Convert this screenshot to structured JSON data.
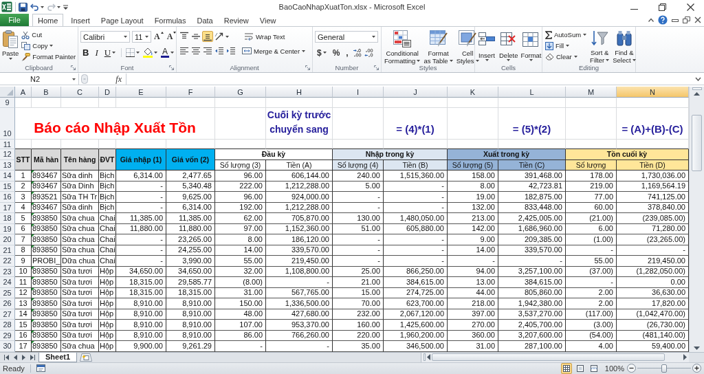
{
  "window": {
    "title": "BaoCaoNhapXuatTon.xlsx - Microsoft Excel"
  },
  "ribbon_tabs": [
    {
      "label": "File",
      "kind": "file",
      "selected": false
    },
    {
      "label": "Home",
      "kind": "tab",
      "selected": true
    },
    {
      "label": "Insert",
      "kind": "tab",
      "selected": false
    },
    {
      "label": "Page Layout",
      "kind": "tab",
      "selected": false
    },
    {
      "label": "Formulas",
      "kind": "tab",
      "selected": false
    },
    {
      "label": "Data",
      "kind": "tab",
      "selected": false
    },
    {
      "label": "Review",
      "kind": "tab",
      "selected": false
    },
    {
      "label": "View",
      "kind": "tab",
      "selected": false
    }
  ],
  "ribbon": {
    "clipboard": {
      "label": "Clipboard",
      "paste": "Paste",
      "cut": "Cut",
      "copy": "Copy",
      "format_painter": "Format Painter"
    },
    "font": {
      "label": "Font",
      "font_name": "Calibri",
      "font_size": "11",
      "grow_font": "A",
      "shrink_font": "A",
      "bold": "B",
      "italic": "I",
      "underline": "U",
      "font_color": "A"
    },
    "alignment": {
      "label": "Alignment",
      "button_rows": [
        [
          {
            "kind": "top",
            "selected": false
          },
          {
            "kind": "middle",
            "selected": false
          },
          {
            "kind": "bottom",
            "selected": true
          },
          {
            "kind": "orientation",
            "selected": false
          }
        ],
        [
          {
            "kind": "left",
            "selected": false
          },
          {
            "kind": "center",
            "selected": false
          },
          {
            "kind": "right",
            "selected": false
          },
          {
            "kind": "outdent",
            "selected": false
          },
          {
            "kind": "indent",
            "selected": false
          }
        ]
      ],
      "wrap_text": "Wrap Text",
      "merge_center": "Merge & Center"
    },
    "number": {
      "label": "Number",
      "format": "General",
      "currency": "$",
      "percent": "%",
      "comma": ","
    },
    "styles": {
      "label": "Styles",
      "buttons": [
        {
          "kind": "conditional",
          "lines": [
            "Conditional",
            "Formatting"
          ]
        },
        {
          "kind": "table",
          "lines": [
            "Format",
            "as Table"
          ]
        },
        {
          "kind": "cell_styles",
          "lines": [
            "Cell",
            "Styles"
          ]
        }
      ]
    },
    "cells": {
      "label": "Cells",
      "buttons": [
        {
          "kind": "insert",
          "label": "Insert"
        },
        {
          "kind": "delete",
          "label": "Delete"
        },
        {
          "kind": "format",
          "label": "Format"
        }
      ]
    },
    "editing": {
      "label": "Editing",
      "autosum": "AutoSum",
      "fill": "Fill",
      "clear": "Clear",
      "buttons": [
        {
          "kind": "sort",
          "lines": [
            "Sort &",
            "Filter"
          ]
        },
        {
          "kind": "find",
          "lines": [
            "Find &",
            "Select"
          ]
        }
      ]
    }
  },
  "formula_bar": {
    "name_box": "N2",
    "function_label": "fx"
  },
  "sheet": {
    "columns": [
      {
        "label": "A",
        "selected": false
      },
      {
        "label": "B",
        "selected": false
      },
      {
        "label": "C",
        "selected": false
      },
      {
        "label": "D",
        "selected": false
      },
      {
        "label": "E",
        "selected": false
      },
      {
        "label": "F",
        "selected": false
      },
      {
        "label": "G",
        "selected": false
      },
      {
        "label": "H",
        "selected": false
      },
      {
        "label": "I",
        "selected": false
      },
      {
        "label": "J",
        "selected": false
      },
      {
        "label": "K",
        "selected": false
      },
      {
        "label": "L",
        "selected": false
      },
      {
        "label": "M",
        "selected": false
      },
      {
        "label": "N",
        "selected": true
      }
    ],
    "row_numbers": [
      "9",
      "10",
      "11",
      "12",
      "13",
      "14",
      "15",
      "16",
      "17",
      "18",
      "19",
      "20",
      "21",
      "22",
      "23",
      "24",
      "25",
      "26",
      "27",
      "28",
      "29",
      "30"
    ],
    "title": "Báo cáo Nhập Xuất Tồn",
    "opening_note": "Cuối kỳ trước chuyển sang",
    "formulas": {
      "import": "= (4)*(1)",
      "export": "= (5)*(2)",
      "closing": "= (A)+(B)-(C)"
    },
    "header": {
      "fixed": [
        "STT",
        "Mã hàn",
        "Tên hàng",
        "ĐVT"
      ],
      "prices": [
        "Giá nhập (1)",
        "Giá vốn (2)"
      ],
      "groups": [
        {
          "label": "Đầu kỳ",
          "color": "#ffffff",
          "columns": [
            "Số lượng (3)",
            "Tiền (A)"
          ]
        },
        {
          "label": "Nhập trong kỳ",
          "color": "#dce6f1",
          "columns": [
            "Số lượng (4)",
            "Tiền (B)"
          ]
        },
        {
          "label": "Xuất trong kỳ",
          "color": "#95b3d7",
          "columns": [
            "Số lượng (5)",
            "Tiền (C)"
          ]
        },
        {
          "label": "Tồn cuối kỳ",
          "color": "#ffe699",
          "columns": [
            "Số lượng",
            "Tiền (D)"
          ]
        }
      ]
    },
    "rows": [
      {
        "flagged": true,
        "cells": [
          "1",
          "893467",
          "Sữa dinh",
          "Bịch",
          "6,314.00",
          "2,477.65",
          "96.00",
          "606,144.00",
          "240.00",
          "1,515,360.00",
          "158.00",
          "391,468.00",
          "178.00",
          "1,730,036.00"
        ]
      },
      {
        "flagged": true,
        "cells": [
          "2",
          "893467",
          "Sữa Dinh",
          "Bịch",
          "-",
          "5,340.48",
          "222.00",
          "1,212,288.00",
          "5.00",
          "-",
          "8.00",
          "42,723.81",
          "219.00",
          "1,169,564.19"
        ]
      },
      {
        "flagged": true,
        "cells": [
          "3",
          "893521",
          "Sữa TH Tr",
          "Bịch",
          "-",
          "9,625.00",
          "96.00",
          "924,000.00",
          "-",
          "-",
          "19.00",
          "182,875.00",
          "77.00",
          "741,125.00"
        ]
      },
      {
        "flagged": true,
        "cells": [
          "4",
          "893467",
          "Sữa dinh",
          "Bịch",
          "-",
          "6,314.00",
          "192.00",
          "1,212,288.00",
          "-",
          "-",
          "132.00",
          "833,448.00",
          "60.00",
          "378,840.00"
        ]
      },
      {
        "flagged": true,
        "cells": [
          "5",
          "893850",
          "Sữa chua",
          "Chai",
          "11,385.00",
          "11,385.00",
          "62.00",
          "705,870.00",
          "130.00",
          "1,480,050.00",
          "213.00",
          "2,425,005.00",
          "(21.00)",
          "(239,085.00)"
        ]
      },
      {
        "flagged": true,
        "cells": [
          "6",
          "893850",
          "Sữa chua",
          "Chai",
          "11,880.00",
          "11,880.00",
          "97.00",
          "1,152,360.00",
          "51.00",
          "605,880.00",
          "142.00",
          "1,686,960.00",
          "6.00",
          "71,280.00"
        ]
      },
      {
        "flagged": true,
        "cells": [
          "7",
          "893850",
          "Sữa chua",
          "Chai",
          "-",
          "23,265.00",
          "8.00",
          "186,120.00",
          "-",
          "-",
          "9.00",
          "209,385.00",
          "(1.00)",
          "(23,265.00)"
        ]
      },
      {
        "flagged": true,
        "cells": [
          "8",
          "893850",
          "Sữa chua",
          "Chai",
          "-",
          "24,255.00",
          "14.00",
          "339,570.00",
          "-",
          "-",
          "14.00",
          "339,570.00",
          "-",
          "-"
        ]
      },
      {
        "flagged": false,
        "cells": [
          "9",
          "PROBI_",
          "Dữa chua",
          "Chai",
          "-",
          "3,990.00",
          "55.00",
          "219,450.00",
          "-",
          "-",
          "-",
          "-",
          "55.00",
          "219,450.00"
        ]
      },
      {
        "flagged": true,
        "cells": [
          "10",
          "893850",
          "Sữa tươi",
          "Hộp",
          "34,650.00",
          "34,650.00",
          "32.00",
          "1,108,800.00",
          "25.00",
          "866,250.00",
          "94.00",
          "3,257,100.00",
          "(37.00)",
          "(1,282,050.00)"
        ]
      },
      {
        "flagged": true,
        "cells": [
          "11",
          "893850",
          "Sữa tươi",
          "Hộp",
          "18,315.00",
          "29,585.77",
          "(8.00)",
          "-",
          "21.00",
          "384,615.00",
          "13.00",
          "384,615.00",
          "-",
          "0.00"
        ]
      },
      {
        "flagged": true,
        "cells": [
          "12",
          "893850",
          "Sữa tươi",
          "Hộp",
          "18,315.00",
          "18,315.00",
          "31.00",
          "567,765.00",
          "15.00",
          "274,725.00",
          "44.00",
          "805,860.00",
          "2.00",
          "36,630.00"
        ]
      },
      {
        "flagged": true,
        "cells": [
          "13",
          "893850",
          "Sữa tươi",
          "Hộp",
          "8,910.00",
          "8,910.00",
          "150.00",
          "1,336,500.00",
          "70.00",
          "623,700.00",
          "218.00",
          "1,942,380.00",
          "2.00",
          "17,820.00"
        ]
      },
      {
        "flagged": true,
        "cells": [
          "14",
          "893850",
          "Sữa tươi",
          "Hộp",
          "8,910.00",
          "8,910.00",
          "48.00",
          "427,680.00",
          "232.00",
          "2,067,120.00",
          "397.00",
          "3,537,270.00",
          "(117.00)",
          "(1,042,470.00)"
        ]
      },
      {
        "flagged": true,
        "cells": [
          "15",
          "893850",
          "Sữa tươi",
          "Hộp",
          "8,910.00",
          "8,910.00",
          "107.00",
          "953,370.00",
          "160.00",
          "1,425,600.00",
          "270.00",
          "2,405,700.00",
          "(3.00)",
          "(26,730.00)"
        ]
      },
      {
        "flagged": true,
        "cells": [
          "16",
          "893850",
          "Sữa tươi",
          "Hộp",
          "8,910.00",
          "8,910.00",
          "86.00",
          "766,260.00",
          "220.00",
          "1,960,200.00",
          "360.00",
          "3,207,600.00",
          "(54.00)",
          "(481,140.00)"
        ]
      },
      {
        "flagged": true,
        "cells": [
          "17",
          "893850",
          "Sữa chua",
          "Hộp",
          "9,900.00",
          "9,261.29",
          "-",
          "-",
          "35.00",
          "346,500.00",
          "31.00",
          "287,100.00",
          "4.00",
          "59,400.00"
        ]
      }
    ]
  },
  "sheet_tabs": [
    {
      "label": "Sheet1",
      "selected": true
    }
  ],
  "status_bar": {
    "status": "Ready",
    "views": [
      {
        "kind": "normal",
        "selected": true
      },
      {
        "kind": "page_layout",
        "selected": false
      },
      {
        "kind": "page_break",
        "selected": false
      }
    ],
    "zoom": "100%",
    "zoom_slider": {
      "level": 0.5
    }
  }
}
